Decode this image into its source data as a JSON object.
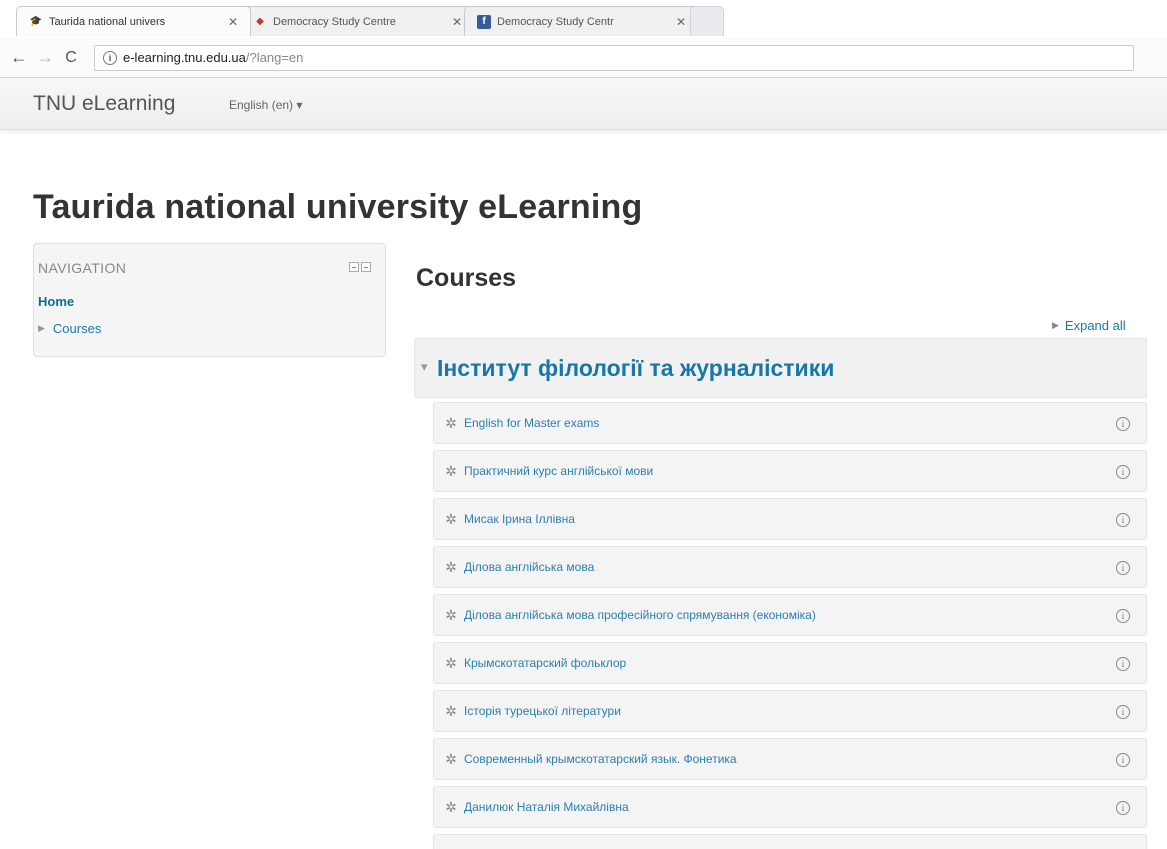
{
  "browser": {
    "tabs": [
      {
        "title": "Taurida national univers",
        "favicon": "moodle-hat-icon",
        "active": true
      },
      {
        "title": "Democracy Study Centre",
        "favicon": "dsc-logo-icon",
        "active": false
      },
      {
        "title": "Democracy Study Centr",
        "favicon": "facebook-icon",
        "active": false
      }
    ],
    "url_host": "e-learning.tnu.edu.ua",
    "url_path": "/?lang=en"
  },
  "site": {
    "brand": "TNU eLearning",
    "language": "English (en) ▾"
  },
  "page": {
    "heading": "Taurida national university eLearning"
  },
  "navigation": {
    "title": "NAVIGATION",
    "home": "Home",
    "courses": "Courses"
  },
  "main": {
    "heading": "Courses",
    "expand_all": "Expand all",
    "category": "Інститут філології та журналістики",
    "courses": [
      "English for Master exams",
      "Практичний курс англійської мови",
      "Мисак Ірина Іллівна",
      "Ділова англійська мова",
      "Ділова англійська мова професійного спрямування (економіка)",
      "Крымскотатарский фольклор",
      "Історія турецької літератури",
      "Современный крымскотатарский язык. Фонетика",
      "Данилюк Наталія Михайлівна"
    ]
  },
  "colors": {
    "link": "#1877a8",
    "heading": "#333333",
    "block_bg": "#f5f5f5"
  }
}
